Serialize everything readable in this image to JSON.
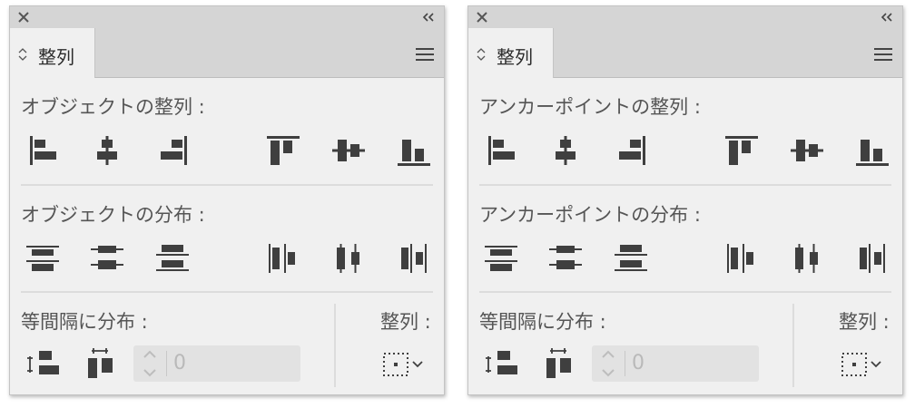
{
  "panels": [
    {
      "id": "left",
      "tab_label": "整列",
      "align_title": "オブジェクトの整列 :",
      "distribute_title": "オブジェクトの分布 :",
      "spacing_title": "等間隔に分布 :",
      "align_to_title": "整列 :",
      "spacing_value": "0"
    },
    {
      "id": "right",
      "tab_label": "整列",
      "align_title": "アンカーポイントの整列 :",
      "distribute_title": "アンカーポイントの分布 :",
      "spacing_title": "等間隔に分布 :",
      "align_to_title": "整列 :",
      "spacing_value": "0"
    }
  ],
  "icons": {
    "align": [
      "horizontal-align-left-icon",
      "horizontal-align-center-icon",
      "horizontal-align-right-icon",
      "vertical-align-top-icon",
      "vertical-align-center-icon",
      "vertical-align-bottom-icon"
    ],
    "distribute": [
      "vertical-distribute-top-icon",
      "vertical-distribute-center-icon",
      "vertical-distribute-bottom-icon",
      "horizontal-distribute-left-icon",
      "horizontal-distribute-center-icon",
      "horizontal-distribute-right-icon"
    ],
    "spacing": [
      "vertical-distribute-space-icon",
      "horizontal-distribute-space-icon"
    ],
    "align_to": "align-to-selection-icon"
  },
  "colors": {
    "panel_bg": "#f0f0f0",
    "header_bg": "#d5d5d5",
    "icon": "#3f3f3f",
    "text": "#555555",
    "disabled": "#b9b9b9"
  }
}
